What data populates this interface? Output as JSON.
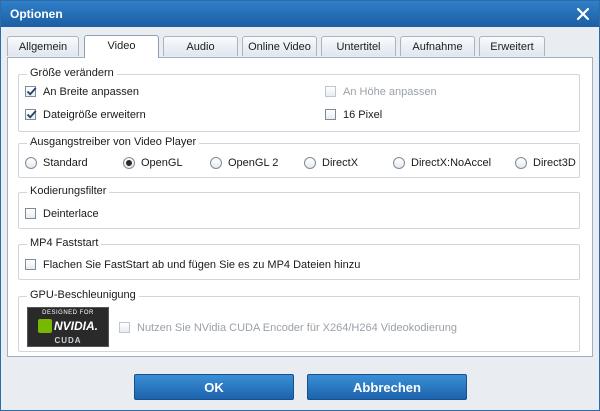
{
  "window": {
    "title": "Optionen"
  },
  "tabs": [
    {
      "label": "Allgemein",
      "active": false
    },
    {
      "label": "Video",
      "active": true
    },
    {
      "label": "Audio",
      "active": false
    },
    {
      "label": "Online Video",
      "active": false
    },
    {
      "label": "Untertitel",
      "active": false
    },
    {
      "label": "Aufnahme",
      "active": false
    },
    {
      "label": "Erweitert",
      "active": false
    }
  ],
  "resize": {
    "legend": "Größe verändern",
    "fit_width": {
      "label": "An Breite anpassen",
      "checked": true
    },
    "fit_height": {
      "label": "An Höhe anpassen",
      "checked": false,
      "disabled": true
    },
    "extend_size": {
      "label": "Dateigröße erweitern",
      "checked": true
    },
    "pixel16": {
      "label": "16 Pixel",
      "checked": false
    }
  },
  "output_driver": {
    "legend": "Ausgangstreiber von Video Player",
    "options": [
      {
        "label": "Standard",
        "selected": false
      },
      {
        "label": "OpenGL",
        "selected": true
      },
      {
        "label": "OpenGL 2",
        "selected": false
      },
      {
        "label": "DirectX",
        "selected": false
      },
      {
        "label": "DirectX:NoAccel",
        "selected": false
      },
      {
        "label": "Direct3D",
        "selected": false
      }
    ]
  },
  "encoding_filter": {
    "legend": "Kodierungsfilter",
    "deinterlace": {
      "label": "Deinterlace",
      "checked": false
    }
  },
  "mp4_faststart": {
    "legend": "MP4 Faststart",
    "faststart": {
      "label": "Flachen Sie FastStart ab und fügen Sie es zu MP4 Dateien hinzu",
      "checked": false
    }
  },
  "gpu": {
    "legend": "GPU-Beschleunigung",
    "logo": {
      "top": "DESIGNED FOR",
      "brand": "NVIDIA.",
      "bottom": "CUDA"
    },
    "cuda": {
      "label": "Nutzen Sie NVidia CUDA Encoder für X264/H264 Videokodierung",
      "checked": false,
      "disabled": true
    }
  },
  "buttons": {
    "ok": "OK",
    "cancel": "Abbrechen"
  },
  "colors": {
    "titlebar": "#1c5ea3",
    "button": "#1d63ad",
    "nvidia_green": "#76b900"
  }
}
